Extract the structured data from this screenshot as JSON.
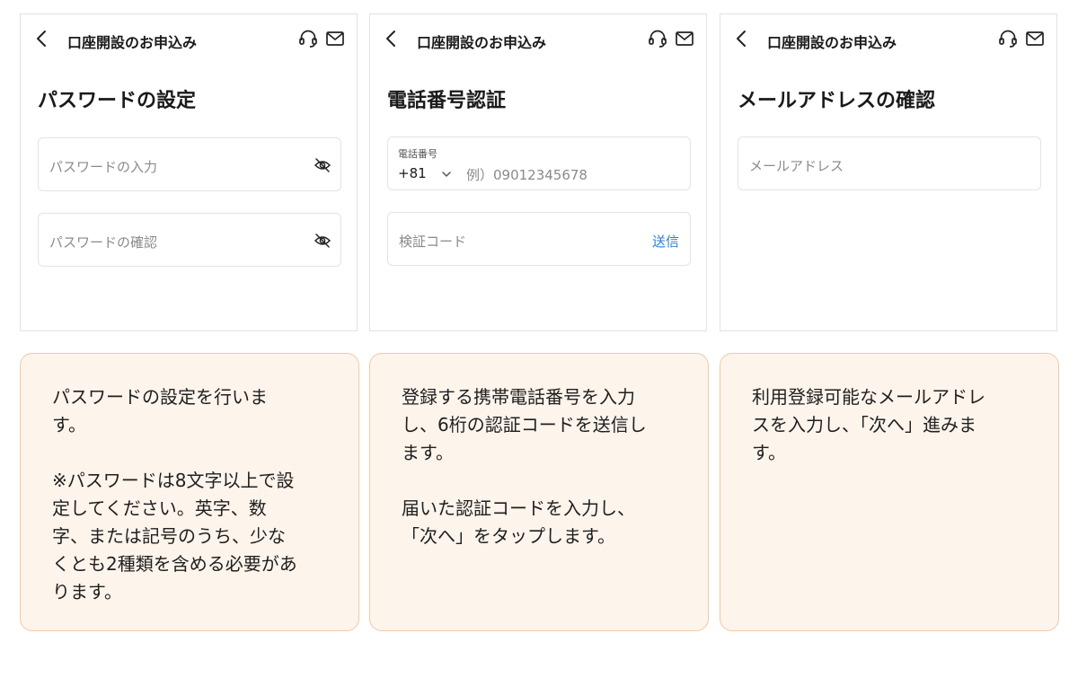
{
  "screens": [
    {
      "header_title": "口座開設のお申込み",
      "title": "パスワードの設定",
      "fields": [
        {
          "placeholder": "パスワードの入力"
        },
        {
          "placeholder": "パスワードの確認"
        }
      ]
    },
    {
      "header_title": "口座開設のお申込み",
      "title": "電話番号認証",
      "phone_field": {
        "label": "電話番号",
        "country_code": "+81",
        "placeholder": "例）09012345678"
      },
      "code_field": {
        "placeholder": "検証コード",
        "send_label": "送信"
      }
    },
    {
      "header_title": "口座開設のお申込み",
      "title": "メールアドレスの確認",
      "fields": [
        {
          "placeholder": "メールアドレス"
        }
      ]
    }
  ],
  "descriptions": [
    {
      "paragraphs": [
        "パスワードの設定を行いま\nす。",
        "※パスワードは8文字以上で設\n定してください。英字、数\n字、または記号のうち、少な\nくとも2種類を含める必要があ\nります。"
      ]
    },
    {
      "paragraphs": [
        "登録する携帯電話番号を入力\nし、6桁の認証コードを送信し\nます。",
        "届いた認証コードを入力し、\n「次へ」をタップします。"
      ]
    },
    {
      "paragraphs": [
        "利用登録可能なメールアドレ\nスを入力し、「次へ」進みま\nす。"
      ]
    }
  ],
  "icons": {
    "back": "chevron-left-icon",
    "support": "headset-icon",
    "mail": "mail-icon",
    "eye": "eye-off-icon",
    "dropdown": "chevron-down-icon"
  },
  "colors": {
    "link": "#2b7fd4",
    "note_background": "#fdf4ec",
    "note_border": "#f2c9a2"
  }
}
